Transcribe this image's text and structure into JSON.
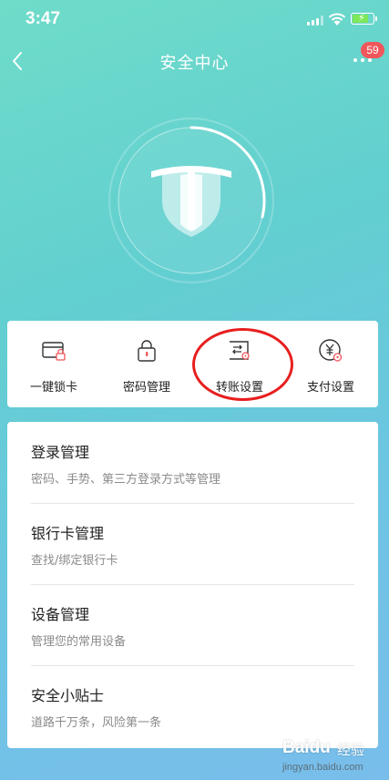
{
  "status_bar": {
    "time": "3:47"
  },
  "nav": {
    "title": "安全中心",
    "badge_count": "59"
  },
  "quick_actions": [
    {
      "label": "一键锁卡",
      "icon": "card-lock-icon"
    },
    {
      "label": "密码管理",
      "icon": "padlock-icon"
    },
    {
      "label": "转账设置",
      "icon": "transfer-settings-icon"
    },
    {
      "label": "支付设置",
      "icon": "yuan-settings-icon"
    }
  ],
  "menu": [
    {
      "title": "登录管理",
      "subtitle": "密码、手势、第三方登录方式等管理"
    },
    {
      "title": "银行卡管理",
      "subtitle": "查找/绑定银行卡"
    },
    {
      "title": "设备管理",
      "subtitle": "管理您的常用设备"
    },
    {
      "title": "安全小贴士",
      "subtitle": "道路千万条，风险第一条"
    }
  ],
  "watermark": {
    "brand": "Baidu",
    "suffix": "经验",
    "url": "jingyan.baidu.com"
  },
  "colors": {
    "accent_icon": "#f0565b",
    "badge": "#f0565b",
    "highlight_ring": "#e81e1e",
    "background_top": "#6fdcc9",
    "background_bottom": "#79bdeb"
  }
}
